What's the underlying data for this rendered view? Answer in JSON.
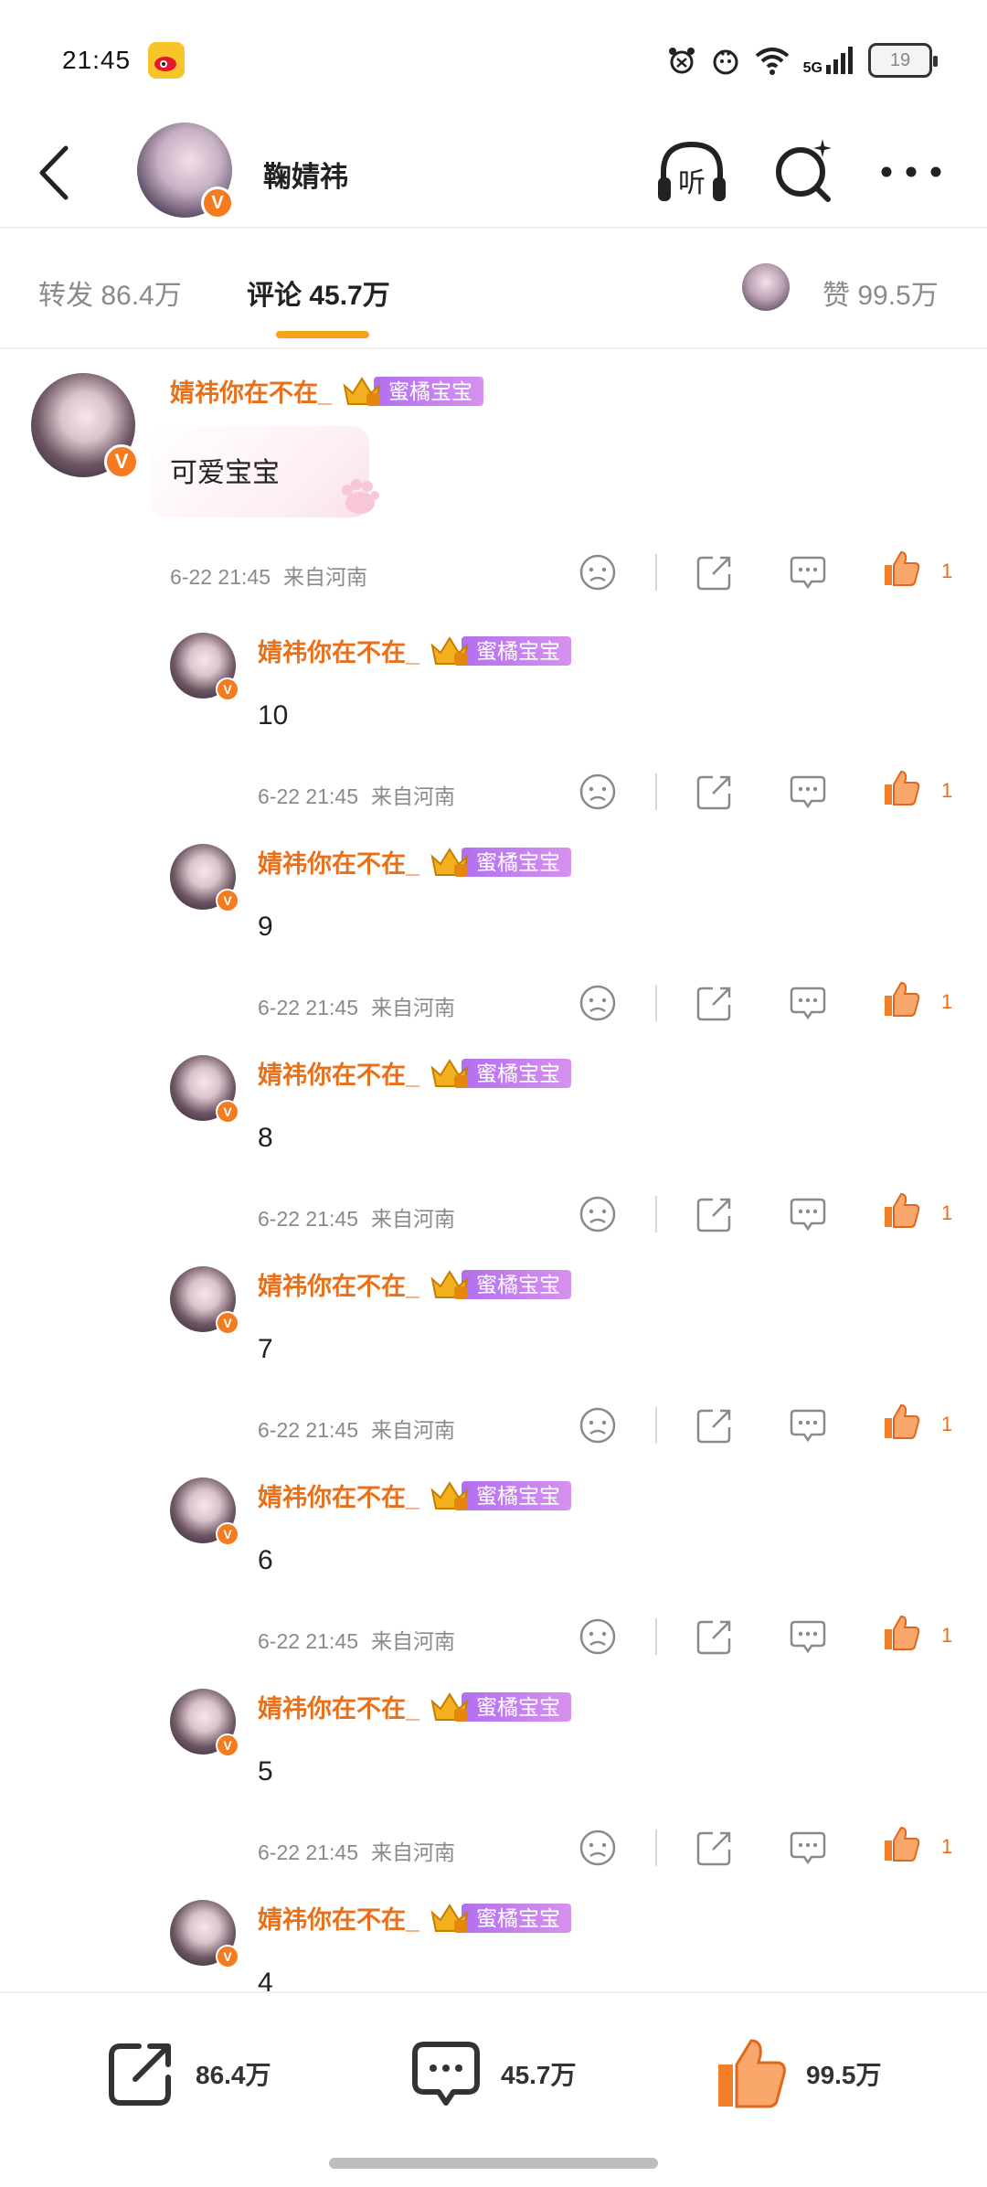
{
  "status": {
    "time": "21:45",
    "network": "5G",
    "battery": "19"
  },
  "header": {
    "name": "鞠婧祎",
    "verified": "V",
    "listen_label": "听"
  },
  "tabs": {
    "repost": "转发 86.4万",
    "comments": "评论 45.7万",
    "likes": "赞 99.5万"
  },
  "main_comment": {
    "username": "婧祎你在不在_",
    "badge": "蜜橘宝宝",
    "text": "可爱宝宝",
    "time": "6-22 21:45",
    "location": "来自河南",
    "likes": "1"
  },
  "replies": [
    {
      "username": "婧祎你在不在_",
      "badge": "蜜橘宝宝",
      "text": "10",
      "time": "6-22 21:45",
      "location": "来自河南",
      "likes": "1"
    },
    {
      "username": "婧祎你在不在_",
      "badge": "蜜橘宝宝",
      "text": "9",
      "time": "6-22 21:45",
      "location": "来自河南",
      "likes": "1"
    },
    {
      "username": "婧祎你在不在_",
      "badge": "蜜橘宝宝",
      "text": "8",
      "time": "6-22 21:45",
      "location": "来自河南",
      "likes": "1"
    },
    {
      "username": "婧祎你在不在_",
      "badge": "蜜橘宝宝",
      "text": "7",
      "time": "6-22 21:45",
      "location": "来自河南",
      "likes": "1"
    },
    {
      "username": "婧祎你在不在_",
      "badge": "蜜橘宝宝",
      "text": "6",
      "time": "6-22 21:45",
      "location": "来自河南",
      "likes": "1"
    },
    {
      "username": "婧祎你在不在_",
      "badge": "蜜橘宝宝",
      "text": "5",
      "time": "6-22 21:45",
      "location": "来自河南",
      "likes": "1"
    },
    {
      "username": "婧祎你在不在_",
      "badge": "蜜橘宝宝",
      "text": "4"
    }
  ],
  "bottom_bar": {
    "repost": "86.4万",
    "comment": "45.7万",
    "like": "99.5万"
  },
  "colors": {
    "accent": "#e8701a",
    "tab_indicator": "#f7a21b",
    "badge": "#c07ef0",
    "verified": "#f47b20"
  }
}
